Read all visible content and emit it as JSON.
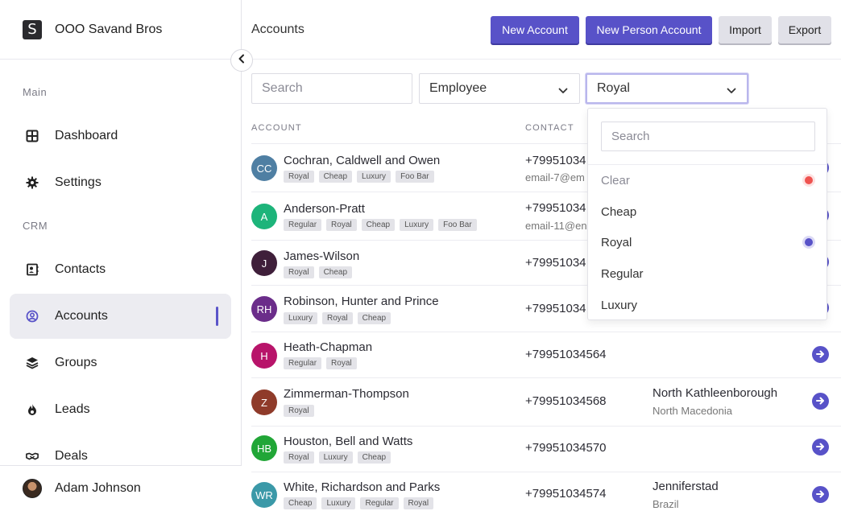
{
  "sidebar": {
    "brand_logo": "S",
    "brand_name": "OOO Savand Bros",
    "sections": {
      "main": "Main",
      "crm": "CRM"
    },
    "items": [
      {
        "label": "Dashboard",
        "icon": "grid-icon"
      },
      {
        "label": "Settings",
        "icon": "gear-icon"
      },
      {
        "label": "Contacts",
        "icon": "contact-card-icon"
      },
      {
        "label": "Accounts",
        "icon": "user-circle-icon",
        "active": true
      },
      {
        "label": "Groups",
        "icon": "layers-icon"
      },
      {
        "label": "Leads",
        "icon": "flame-icon"
      },
      {
        "label": "Deals",
        "icon": "handshake-icon"
      }
    ],
    "user": {
      "name": "Adam Johnson"
    }
  },
  "header": {
    "title": "Accounts",
    "buttons": {
      "new_account": "New Account",
      "new_person_account": "New Person Account",
      "import": "Import",
      "export": "Export"
    }
  },
  "filters": {
    "search_placeholder": "Search",
    "type_value": "Employee",
    "tag_value": "Royal"
  },
  "table": {
    "columns": {
      "account": "ACCOUNT",
      "contact": "CONTACT"
    },
    "rows": [
      {
        "initials": "CC",
        "color": "#4f7fa3",
        "name": "Cochran, Caldwell and Owen",
        "tags": [
          "Royal",
          "Cheap",
          "Luxury",
          "Foo Bar"
        ],
        "phone": "+79951034",
        "email": "email-7@em",
        "city": "",
        "country": ""
      },
      {
        "initials": "A",
        "color": "#1db47a",
        "name": "Anderson-Pratt",
        "tags": [
          "Regular",
          "Royal",
          "Cheap",
          "Luxury",
          "Foo Bar"
        ],
        "phone": "+79951034",
        "email": "email-11@en",
        "city": "",
        "country": ""
      },
      {
        "initials": "J",
        "color": "#3f1f3a",
        "name": "James-Wilson",
        "tags": [
          "Royal",
          "Cheap"
        ],
        "phone": "+79951034",
        "email": "",
        "city": "",
        "country": ""
      },
      {
        "initials": "RH",
        "color": "#6b2d8a",
        "name": "Robinson, Hunter and Prince",
        "tags": [
          "Luxury",
          "Royal",
          "Cheap"
        ],
        "phone": "+79951034",
        "email": "",
        "city": "",
        "country": ""
      },
      {
        "initials": "H",
        "color": "#b8146a",
        "name": "Heath-Chapman",
        "tags": [
          "Regular",
          "Royal"
        ],
        "phone": "+79951034564",
        "email": "",
        "city": "",
        "country": ""
      },
      {
        "initials": "Z",
        "color": "#8f3b2a",
        "name": "Zimmerman-Thompson",
        "tags": [
          "Royal"
        ],
        "phone": "+79951034568",
        "email": "",
        "city": "North Kathleenborough",
        "country": "North Macedonia"
      },
      {
        "initials": "HB",
        "color": "#21a637",
        "name": "Houston, Bell and Watts",
        "tags": [
          "Royal",
          "Luxury",
          "Cheap"
        ],
        "phone": "+79951034570",
        "email": "",
        "city": "",
        "country": ""
      },
      {
        "initials": "WR",
        "color": "#3b99a8",
        "name": "White, Richardson and Parks",
        "tags": [
          "Cheap",
          "Luxury",
          "Regular",
          "Royal"
        ],
        "phone": "+79951034574",
        "email": "",
        "city": "Jenniferstad",
        "country": "Brazil"
      }
    ]
  },
  "dropdown": {
    "search_placeholder": "Search",
    "options": [
      {
        "label": "Clear",
        "indicator": "#ef5350"
      },
      {
        "label": "Cheap"
      },
      {
        "label": "Royal",
        "indicator": "#5852c8"
      },
      {
        "label": "Regular"
      },
      {
        "label": "Luxury"
      }
    ]
  },
  "colors": {
    "accent": "#5852c8",
    "clear": "#ef5350"
  }
}
